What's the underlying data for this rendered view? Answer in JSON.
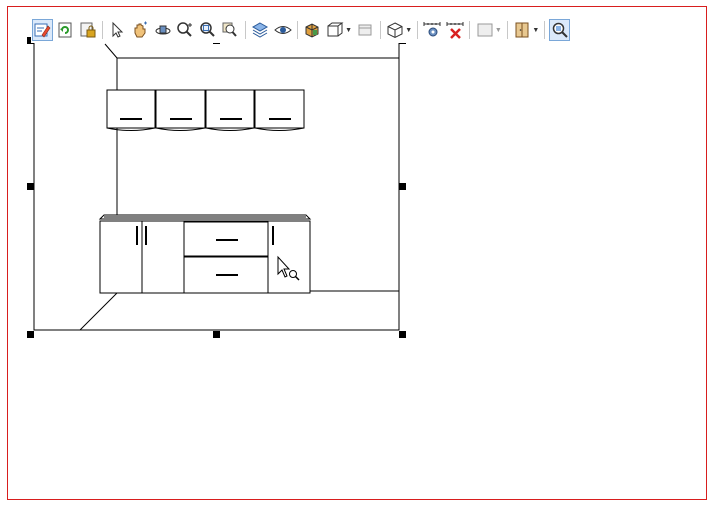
{
  "document": {
    "border_color": "#d81e1e",
    "background": "#ffffff"
  },
  "toolbar": {
    "buttons": [
      {
        "icon": "edit-icon",
        "active": true
      },
      {
        "icon": "refresh-icon"
      },
      {
        "icon": "lock-file-icon"
      },
      {
        "icon": "select-arrow-icon"
      },
      {
        "icon": "pan-hand-icon"
      },
      {
        "icon": "orbit-icon"
      },
      {
        "icon": "zoom-realtime-icon"
      },
      {
        "icon": "zoom-window-icon"
      },
      {
        "icon": "zoom-previous-icon"
      },
      {
        "icon": "layers-icon"
      },
      {
        "icon": "visibility-eye-icon"
      },
      {
        "icon": "shade-icon"
      },
      {
        "icon": "view-cube-icon"
      },
      {
        "icon": "panel-icon"
      },
      {
        "icon": "box-3d-icon"
      },
      {
        "icon": "dimension-settings-icon"
      },
      {
        "icon": "dimension-delete-icon"
      },
      {
        "icon": "color-swatch-icon"
      },
      {
        "icon": "door-icon"
      },
      {
        "icon": "zoom-fit-icon",
        "active": true
      }
    ]
  },
  "viewport": {
    "selection_color": "#000000",
    "cursor": "zoom-cursor-icon"
  }
}
